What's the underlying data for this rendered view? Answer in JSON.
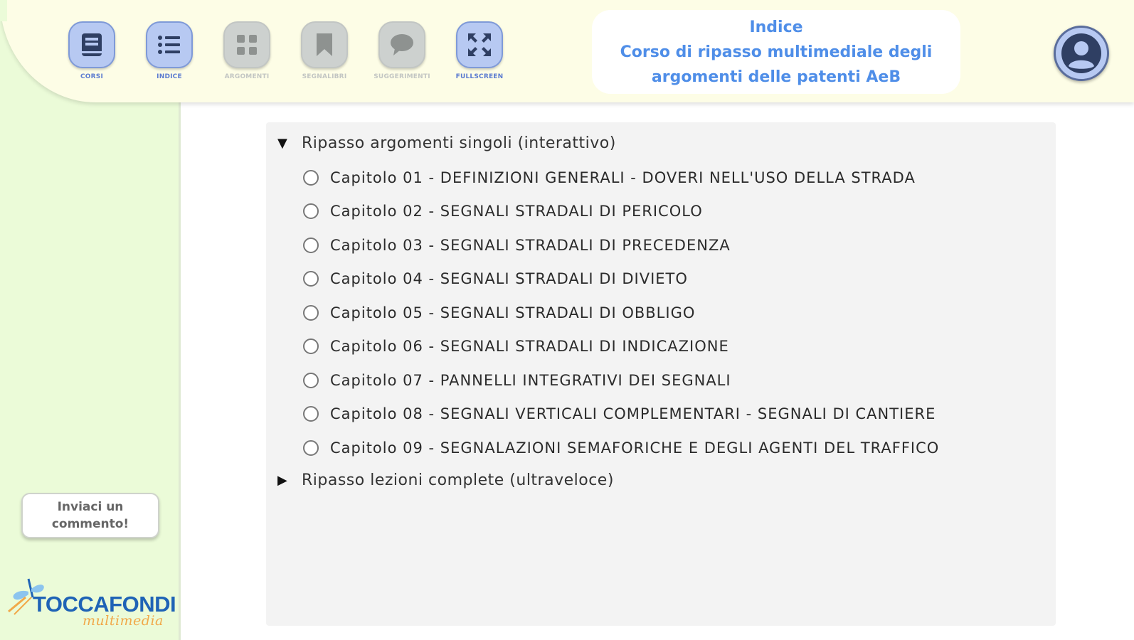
{
  "toolbar": {
    "items": [
      {
        "label": "CORSI",
        "icon": "book-icon",
        "enabled": true
      },
      {
        "label": "INDICE",
        "icon": "list-icon",
        "enabled": true
      },
      {
        "label": "ARGOMENTI",
        "icon": "grid-icon",
        "enabled": false
      },
      {
        "label": "SEGNALIBRI",
        "icon": "bookmark-icon",
        "enabled": false
      },
      {
        "label": "SUGGERIMENTI",
        "icon": "speech-bubble-icon",
        "enabled": false
      },
      {
        "label": "FULLSCREEN",
        "icon": "fullscreen-icon",
        "enabled": true
      }
    ]
  },
  "header": {
    "title": "Indice",
    "subtitle_line1": "Corso di ripasso multimediale degli",
    "subtitle_line2": "argomenti delle patenti AeB",
    "avatar_icon": "user-avatar-icon"
  },
  "index": {
    "sections": [
      {
        "label": "Ripasso argomenti singoli (interattivo)",
        "expanded": true,
        "chapters": [
          "Capitolo 01 - DEFINIZIONI GENERALI - DOVERI NELL'USO DELLA STRADA",
          "Capitolo 02 - SEGNALI STRADALI DI PERICOLO",
          "Capitolo 03 - SEGNALI STRADALI DI PRECEDENZA",
          "Capitolo 04 - SEGNALI STRADALI DI DIVIETO",
          "Capitolo 05 - SEGNALI STRADALI DI OBBLIGO",
          "Capitolo 06 - SEGNALI STRADALI DI INDICAZIONE",
          "Capitolo 07 - PANNELLI INTEGRATIVI DEI SEGNALI",
          "Capitolo 08 - SEGNALI VERTICALI COMPLEMENTARI - SEGNALI DI CANTIERE",
          "Capitolo 09 - SEGNALAZIONI SEMAFORICHE E DEGLI AGENTI DEL TRAFFICO"
        ]
      },
      {
        "label": "Ripasso lezioni complete (ultraveloce)",
        "expanded": false
      }
    ],
    "arrow_expanded": "▼",
    "arrow_collapsed": "▶"
  },
  "sidebar": {
    "comment_button": "Inviaci un commento!",
    "logo_name": "TOCCAFONDI",
    "logo_sub": "multimedia"
  },
  "colors": {
    "accent_blue": "#4f8ee8",
    "button_blue": "#b7c9f2",
    "sidebar_green": "#ebfbd8",
    "header_yellow": "#fdfde6",
    "logo_blue": "#1f63b6",
    "logo_orange": "#f1a94a"
  }
}
